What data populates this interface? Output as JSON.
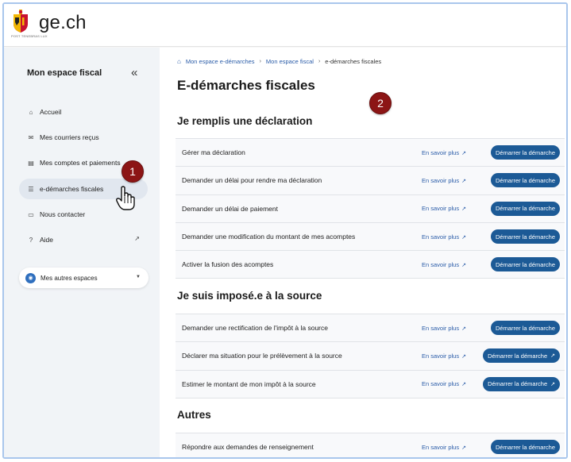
{
  "header": {
    "brand": "ge.ch",
    "logo_subtext": "POST TENEBRAS LUX"
  },
  "sidebar": {
    "title": "Mon espace fiscal",
    "collapse_icon": "double-chevron-left-icon",
    "items": [
      {
        "label": "Accueil",
        "icon": "home-icon"
      },
      {
        "label": "Mes courriers reçus",
        "icon": "mail-icon"
      },
      {
        "label": "Mes comptes et paiements",
        "icon": "wallet-icon"
      },
      {
        "label": "e-démarches fiscales",
        "icon": "checklist-icon",
        "active": true
      },
      {
        "label": "Nous contacter",
        "icon": "chat-icon"
      },
      {
        "label": "Aide",
        "icon": "help-icon",
        "external": true
      }
    ],
    "spaces_button": "Mes autres espaces"
  },
  "annotations": {
    "badge1": "1",
    "badge2": "2",
    "badge_color": "#8c1515"
  },
  "main": {
    "breadcrumb": [
      "Mon espace e-démarches",
      "Mon espace fiscal",
      "e-démarches fiscales"
    ],
    "title": "E-démarches fiscales",
    "more_label": "En savoir plus",
    "start_label": "Démarrer la démarche",
    "accent_color": "#1c5a96",
    "sections": [
      {
        "title": "Je remplis une déclaration",
        "rows": [
          "Gérer ma déclaration",
          "Demander un délai pour rendre ma déclaration",
          "Demander un délai de paiement",
          "Demander une modification du montant de mes acomptes",
          "Activer la fusion des acomptes"
        ]
      },
      {
        "title": "Je suis imposé.e à la source",
        "rows": [
          "Demander une rectification de l'impôt à la source",
          "Déclarer ma situation pour le prélèvement à la source",
          "Estimer le montant de mon impôt à la source"
        ]
      },
      {
        "title": "Autres",
        "rows": [
          "Répondre aux demandes de renseignement"
        ]
      }
    ]
  }
}
